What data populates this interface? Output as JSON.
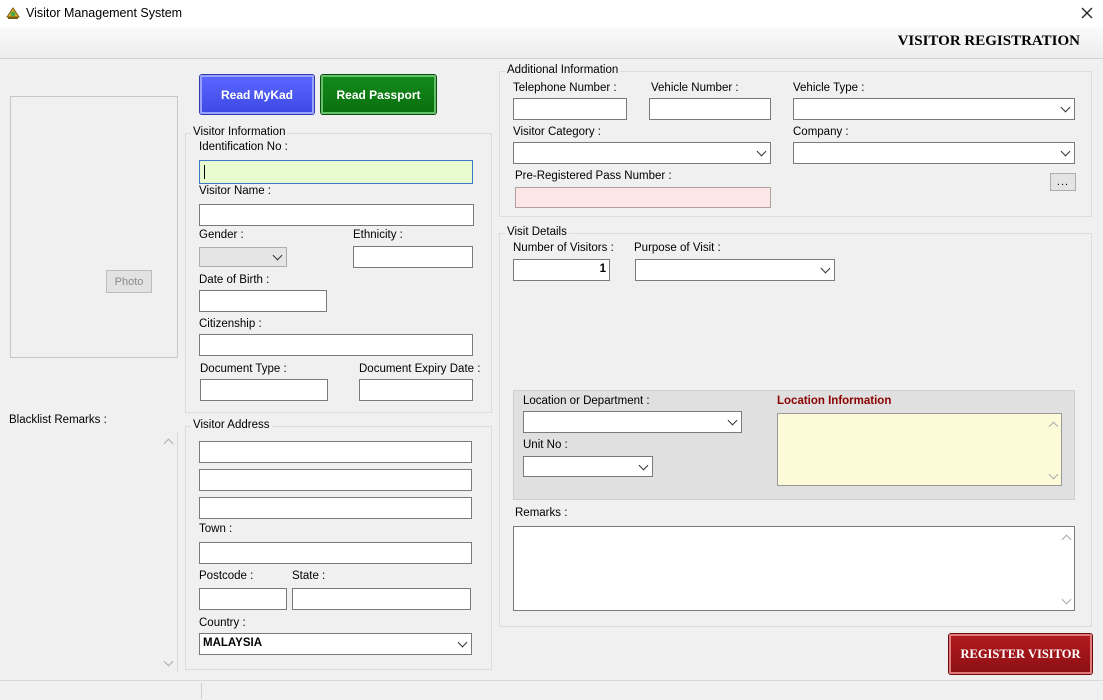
{
  "window": {
    "title": "Visitor Management System"
  },
  "header": {
    "title": "VISITOR REGISTRATION"
  },
  "buttons": {
    "read_mykad": "Read MyKad",
    "read_passport": "Read Passport",
    "photo": "Photo",
    "register": "REGISTER VISITOR",
    "more": "..."
  },
  "left": {
    "blacklist_label": "Blacklist Remarks :"
  },
  "visitor_info": {
    "title": "Visitor Information",
    "identification_no": "Identification No :",
    "visitor_name": "Visitor Name :",
    "gender": "Gender :",
    "ethnicity": "Ethnicity :",
    "date_of_birth": "Date of Birth :",
    "citizenship": "Citizenship :",
    "document_type": "Document Type :",
    "document_expiry": "Document Expiry Date :"
  },
  "visitor_address": {
    "title": "Visitor Address",
    "town": "Town :",
    "postcode": "Postcode :",
    "state": "State :",
    "country": "Country :",
    "country_value": "MALAYSIA"
  },
  "additional_info": {
    "title": "Additional Information",
    "telephone": "Telephone Number :",
    "vehicle_number": "Vehicle Number :",
    "vehicle_type": "Vehicle Type :",
    "visitor_category": "Visitor Category :",
    "company": "Company :",
    "pre_registered": "Pre-Registered Pass Number :"
  },
  "visit_details": {
    "title": "Visit Details",
    "num_visitors": "Number of Visitors :",
    "num_visitors_value": "1",
    "purpose": "Purpose of Visit :",
    "location_dept": "Location or Department :",
    "unit_no": "Unit No :",
    "location_info": "Location Information",
    "remarks": "Remarks :"
  },
  "colors": {
    "mykad_button": "#4a55f0",
    "passport_button": "#0a7a10",
    "register_button": "#a01418",
    "id_field_bg": "#e8fcd0",
    "prereg_field_bg": "#fde6e6",
    "location_info_bg": "#fdfad8",
    "location_info_title": "#8b0000"
  }
}
